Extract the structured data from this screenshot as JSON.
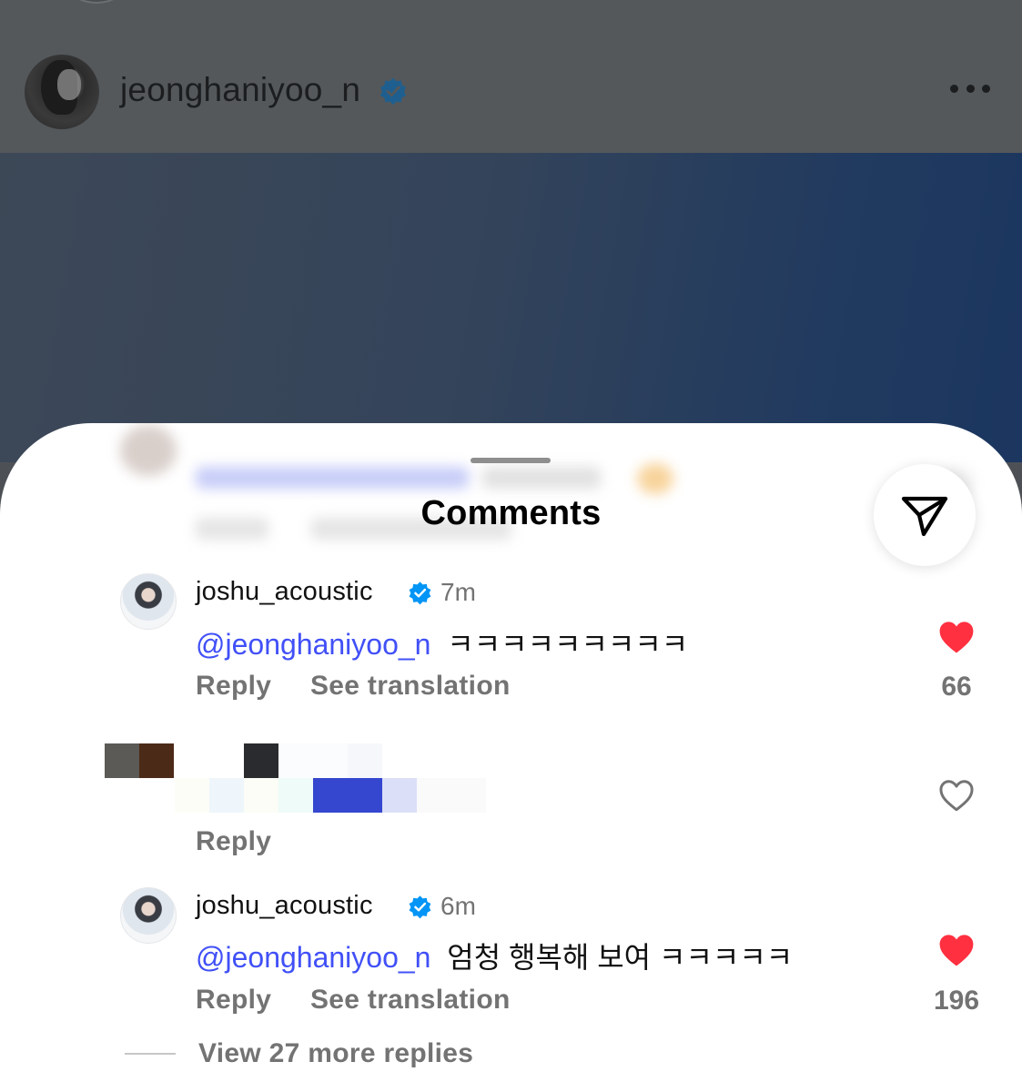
{
  "post": {
    "username": "jeonghaniyoo_n",
    "verified": true,
    "more_icon": "more-horizontal-icon"
  },
  "sheet": {
    "title": "Comments",
    "share_icon": "send-paper-plane-icon"
  },
  "comments": [
    {
      "username": "joshu_acoustic",
      "verified": true,
      "time": "7m",
      "mention": "@jeonghaniyoo_n",
      "text": "ㅋㅋㅋㅋㅋㅋㅋㅋㅋ",
      "reply_label": "Reply",
      "translate_label": "See translation",
      "liked": true,
      "like_count": "66"
    },
    {
      "censored": true,
      "reply_label": "Reply",
      "liked": false
    },
    {
      "username": "joshu_acoustic",
      "verified": true,
      "time": "6m",
      "mention": "@jeonghaniyoo_n",
      "text": "엄청 행복해 보여 ㅋㅋㅋㅋㅋ",
      "reply_label": "Reply",
      "translate_label": "See translation",
      "liked": true,
      "like_count": "196"
    }
  ],
  "view_more_replies": "View 27 more replies",
  "colors": {
    "mention": "#4150f7",
    "verified": "#0095f6",
    "like": "#ff3040",
    "muted": "#737373"
  }
}
